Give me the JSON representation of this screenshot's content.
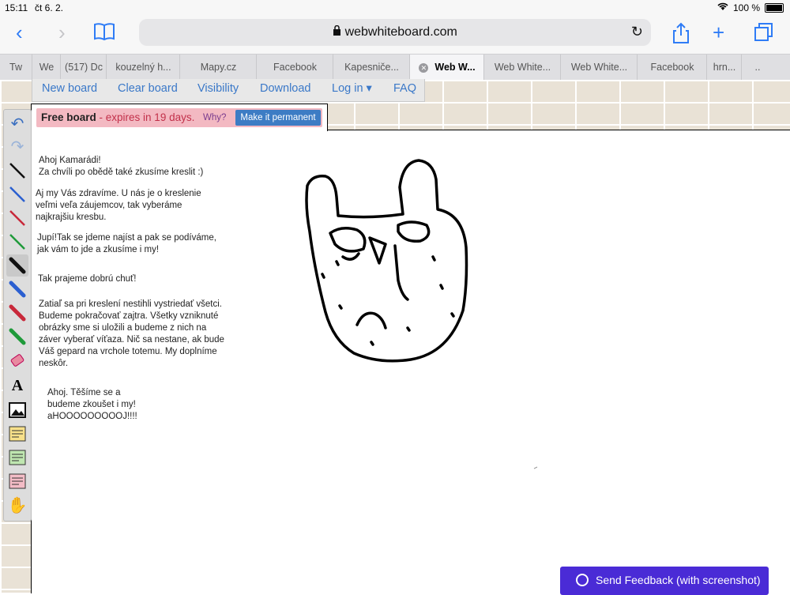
{
  "status": {
    "time": "15:11",
    "date": "čt 6. 2.",
    "battery": "100 %"
  },
  "browser": {
    "url": "webwhiteboard.com"
  },
  "tabs": [
    {
      "label": "Tw"
    },
    {
      "label": "We"
    },
    {
      "label": "(517) Dc"
    },
    {
      "label": "kouzelný h..."
    },
    {
      "label": "Mapy.cz"
    },
    {
      "label": "Facebook"
    },
    {
      "label": "Kapesniče..."
    },
    {
      "label": "Web W...",
      "active": true
    },
    {
      "label": "Web White..."
    },
    {
      "label": "Web White..."
    },
    {
      "label": "Facebook"
    },
    {
      "label": "hrn..."
    },
    {
      "label": ".."
    }
  ],
  "menu": {
    "new_board": "New board",
    "clear_board": "Clear board",
    "visibility": "Visibility",
    "download": "Download",
    "login": "Log in ▾",
    "faq": "FAQ"
  },
  "free_board": {
    "title": "Free board",
    "expires": " - expires in 19 days.",
    "why": "Why?",
    "make_permanent": "Make it permanent"
  },
  "notes": {
    "n1": "Ahoj Kamarádi!\nZa chvíli po obědě také zkusíme kreslit :)",
    "n2": "Aj my Vás zdravíme. U nás je o kreslenie\nveľmi veľa záujemcov, tak vyberáme\nnajkrajšiu kresbu.",
    "n3": "Jupí!Tak se jdeme najíst a pak se podíváme,\njak vám to jde a zkusíme i my!",
    "n4": "Tak prajeme dobrú chuť!",
    "n5": "Zatiaľ sa pri kreslení nestihli vystriedať všetci.\nBudeme pokračovať zajtra. Všetky vzniknuté\nobrázky sme si uložili a budeme z nich na\nzáver vyberať víťaza. Nič sa nestane, ak bude\nVáš gepard na vrchole totemu. My doplníme\nneskôr.",
    "n6": "Ahoj. Těšíme se a\nbudeme zkoušet i my!\naHOOOOOOOOOJ!!!!"
  },
  "feedback": {
    "label": "Send Feedback (with screenshot)"
  },
  "colors": {
    "accent": "#3a78c8",
    "feedback": "#4a2bd6",
    "free_banner": "#f3b9c2"
  }
}
